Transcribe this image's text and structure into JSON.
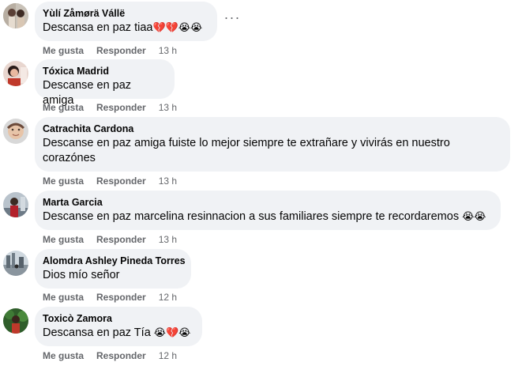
{
  "more_label": "···",
  "actions": {
    "like": "Me gusta",
    "reply": "Responder"
  },
  "comments": [
    {
      "author": "Yùlí Zåmørä Vállë",
      "text": "Descansa en paz tiaa",
      "emojis": "💔💔😭😭",
      "time": "13 h"
    },
    {
      "author": "Tóxica Madrid",
      "text": "Descanse en paz amiga",
      "emojis": "",
      "time": "13 h"
    },
    {
      "author": "Catrachita Cardona",
      "text": "Descanse en paz amiga fuiste lo mejor siempre te extrañare y vivirás en nuestro corazónes",
      "emojis": "",
      "time": "13 h"
    },
    {
      "author": "Marta Garcia",
      "text": "Descanse en paz marcelina resinnacion a sus familiares siempre te recordaremos",
      "emojis": "😭😭",
      "time": "13 h"
    },
    {
      "author": "Alomdra Ashley Pineda Torres",
      "text": "Dios mío señor",
      "emojis": "",
      "time": "12 h"
    },
    {
      "author": "Toxicò Zamora",
      "text": "Descansa en paz Tía",
      "emojis": "😭💔😭",
      "time": "12 h"
    }
  ]
}
